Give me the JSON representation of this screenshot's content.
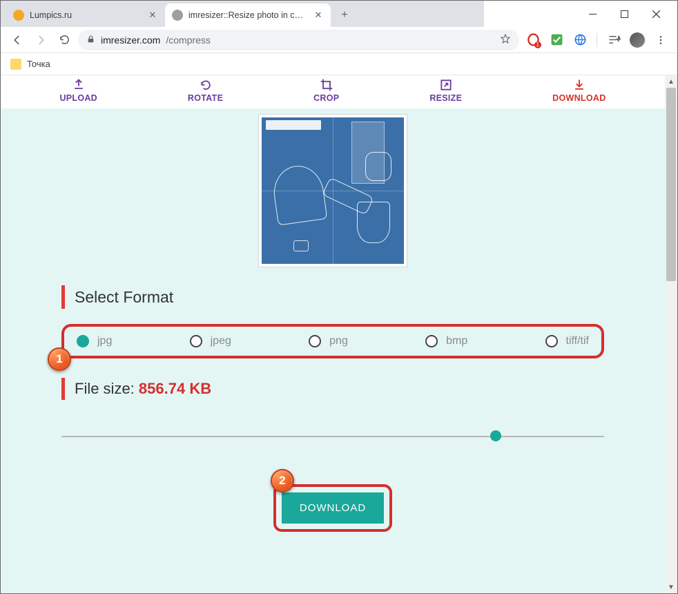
{
  "browser": {
    "tabs": [
      {
        "title": "Lumpics.ru",
        "favicon_color": "#f5a623",
        "active": false
      },
      {
        "title": "imresizer::Resize photo in cm, mm",
        "favicon_color": "#9e9e9e",
        "active": true
      }
    ],
    "url_host": "imresizer.com",
    "url_path": "/compress",
    "bookmark": "Точка",
    "ext_badge": "1"
  },
  "steps": {
    "upload": "UPLOAD",
    "rotate": "ROTATE",
    "crop": "CROP",
    "resize": "RESIZE",
    "download": "DOWNLOAD"
  },
  "section": {
    "select_format": "Select Format"
  },
  "formats": {
    "jpg": "jpg",
    "jpeg": "jpeg",
    "png": "png",
    "bmp": "bmp",
    "tiff": "tiff/tif"
  },
  "filesize": {
    "label": "File size: ",
    "value": "856.74 KB"
  },
  "slider": {
    "percent": 80
  },
  "download_btn": "DOWNLOAD",
  "annotations": {
    "badge1": "1",
    "badge2": "2"
  }
}
